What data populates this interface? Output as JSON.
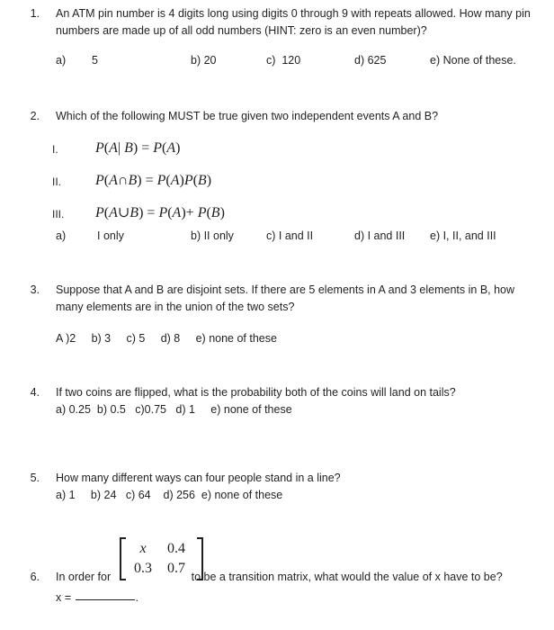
{
  "document": {
    "questions": [
      {
        "number": "1.",
        "text": "An ATM pin number is 4 digits long using digits 0 through 9 with repeats allowed. How many pin numbers are made up of all odd numbers (HINT: zero is an even number)?",
        "options": [
          {
            "label": "a)",
            "value": "5"
          },
          {
            "label": "b) 20",
            "value": ""
          },
          {
            "label": "c)  120",
            "value": ""
          },
          {
            "label": "d) 625",
            "value": ""
          },
          {
            "label": "e) None of these.",
            "value": ""
          }
        ]
      },
      {
        "number": "2.",
        "text": "Which of the following MUST be true given two independent events A and B?",
        "statements": [
          {
            "label": "I.",
            "math": "P(A| B) = P(A)"
          },
          {
            "label": "II.",
            "math": "P(A∩B) = P(A)P(B)"
          },
          {
            "label": "III.",
            "math": "P(A∪B) = P(A)+ P(B)"
          }
        ],
        "options": [
          {
            "label": "a)",
            "value": "I only"
          },
          {
            "label": "b) II only",
            "value": ""
          },
          {
            "label": "c) I and II",
            "value": ""
          },
          {
            "label": "d) I and III",
            "value": ""
          },
          {
            "label": "e) I, II, and III",
            "value": ""
          }
        ]
      },
      {
        "number": "3.",
        "text": "Suppose that A and B are disjoint sets. If there are 5 elements in A and 3 elements in B, how many elements are in the union of the two sets?",
        "options_inline": "A )2     b) 3     c) 5     d) 8     e) none of these"
      },
      {
        "number": "4.",
        "text": "If two coins are flipped, what is the probability both of the coins will land on tails?",
        "options_inline": "a) 0.25  b) 0.5   c)0.75   d) 1     e) none of these"
      },
      {
        "number": "5.",
        "text": "How many different ways can four people stand in a line?",
        "options_inline": "a) 1     b) 24   c) 64    d) 256  e) none of these"
      },
      {
        "number": "6.",
        "text_before": "In order for",
        "text_after": "to be a transition matrix, what would the value of x have to be?",
        "matrix": {
          "rows": [
            [
              "x",
              "0.4"
            ],
            [
              "0.3",
              "0.7"
            ]
          ]
        },
        "answer_prompt_prefix": "x = ",
        "answer_prompt_suffix": "."
      }
    ]
  }
}
